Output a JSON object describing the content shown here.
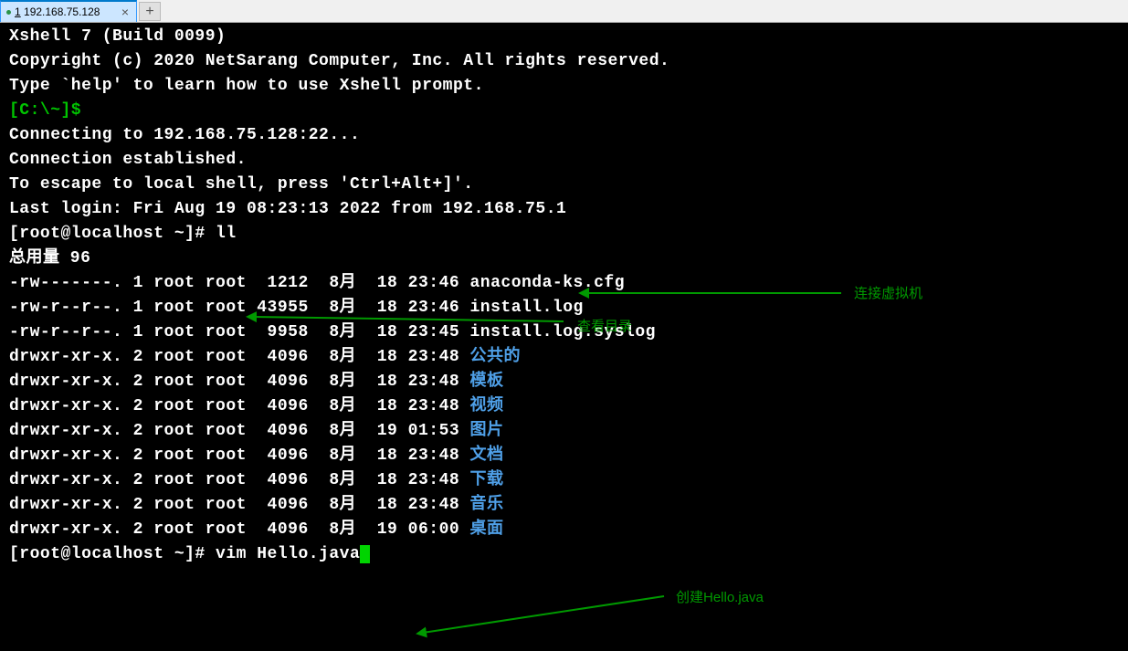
{
  "tab": {
    "num": "1",
    "title": "192.168.75.128",
    "close": "×",
    "add": "+"
  },
  "term": {
    "l0": "Xshell 7 (Build 0099)",
    "l1": "Copyright (c) 2020 NetSarang Computer, Inc. All rights reserved.",
    "l2": "",
    "l3": "Type `help' to learn how to use Xshell prompt.",
    "l4a": "[C:\\~]$",
    "l4b": " ",
    "l5": "",
    "l6": "Connecting to 192.168.75.128:22...",
    "l7": "Connection established.",
    "l8": "To escape to local shell, press 'Ctrl+Alt+]'.",
    "l9": "",
    "l10": "Last login: Fri Aug 19 08:23:13 2022 from 192.168.75.1",
    "l11a": "[root@localhost ~]# ll",
    "l12": "总用量 96",
    "f0": {
      "meta": "-rw-------. 1 root root  1212  8月  18 23:46 ",
      "name": "anaconda-ks.cfg",
      "dir": false
    },
    "f1": {
      "meta": "-rw-r--r--. 1 root root 43955  8月  18 23:46 ",
      "name": "install.log",
      "dir": false
    },
    "f2": {
      "meta": "-rw-r--r--. 1 root root  9958  8月  18 23:45 ",
      "name": "install.log.syslog",
      "dir": false
    },
    "f3": {
      "meta": "drwxr-xr-x. 2 root root  4096  8月  18 23:48 ",
      "name": "公共的",
      "dir": true
    },
    "f4": {
      "meta": "drwxr-xr-x. 2 root root  4096  8月  18 23:48 ",
      "name": "模板",
      "dir": true
    },
    "f5": {
      "meta": "drwxr-xr-x. 2 root root  4096  8月  18 23:48 ",
      "name": "视频",
      "dir": true
    },
    "f6": {
      "meta": "drwxr-xr-x. 2 root root  4096  8月  19 01:53 ",
      "name": "图片",
      "dir": true
    },
    "f7": {
      "meta": "drwxr-xr-x. 2 root root  4096  8月  18 23:48 ",
      "name": "文档",
      "dir": true
    },
    "f8": {
      "meta": "drwxr-xr-x. 2 root root  4096  8月  18 23:48 ",
      "name": "下载",
      "dir": true
    },
    "f9": {
      "meta": "drwxr-xr-x. 2 root root  4096  8月  18 23:48 ",
      "name": "音乐",
      "dir": true
    },
    "f10": {
      "meta": "drwxr-xr-x. 2 root root  4096  8月  19 06:00 ",
      "name": "桌面",
      "dir": true
    },
    "l_cmd": "[root@localhost ~]# vim Hello.java"
  },
  "anno": {
    "a1": "连接虚拟机",
    "a2": "查看目录",
    "a3": "创建Hello.java"
  }
}
